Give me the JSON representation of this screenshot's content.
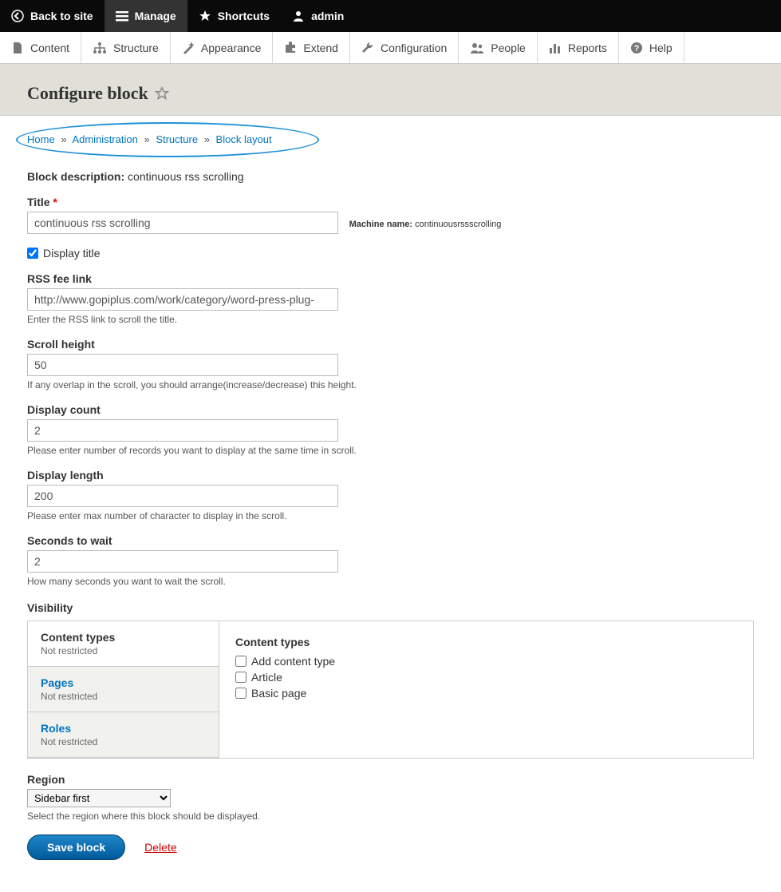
{
  "topbar": {
    "back": "Back to site",
    "manage": "Manage",
    "shortcuts": "Shortcuts",
    "admin": "admin"
  },
  "adminmenu": {
    "content": "Content",
    "structure": "Structure",
    "appearance": "Appearance",
    "extend": "Extend",
    "configuration": "Configuration",
    "people": "People",
    "reports": "Reports",
    "help": "Help"
  },
  "page_title": "Configure block",
  "breadcrumb": {
    "home": "Home",
    "administration": "Administration",
    "structure": "Structure",
    "block_layout": "Block layout"
  },
  "block_description_label": "Block description:",
  "block_description_value": "continuous rss scrolling",
  "fields": {
    "title": {
      "label": "Title",
      "value": "continuous rss scrolling"
    },
    "machine_name": {
      "label": "Machine name:",
      "value": "continuousrssscrolling"
    },
    "display_title": {
      "label": "Display title",
      "checked": true
    },
    "rss_link": {
      "label": "RSS fee link",
      "value": "http://www.gopiplus.com/work/category/word-press-plug-",
      "desc": "Enter the RSS link to scroll the title."
    },
    "scroll_height": {
      "label": "Scroll height",
      "value": "50",
      "desc": "If any overlap in the scroll, you should arrange(increase/decrease) this height."
    },
    "display_count": {
      "label": "Display count",
      "value": "2",
      "desc": "Please enter number of records you want to display at the same time in scroll."
    },
    "display_length": {
      "label": "Display length",
      "value": "200",
      "desc": "Please enter max number of character to display in the scroll."
    },
    "seconds_wait": {
      "label": "Seconds to wait",
      "value": "2",
      "desc": "How many seconds you want to wait the scroll."
    }
  },
  "visibility": {
    "heading": "Visibility",
    "tabs": [
      {
        "title": "Content types",
        "sub": "Not restricted"
      },
      {
        "title": "Pages",
        "sub": "Not restricted"
      },
      {
        "title": "Roles",
        "sub": "Not restricted"
      }
    ],
    "panel_title": "Content types",
    "options": [
      "Add content type",
      "Article",
      "Basic page"
    ]
  },
  "region": {
    "label": "Region",
    "selected": "Sidebar first",
    "desc": "Select the region where this block should be displayed."
  },
  "actions": {
    "save": "Save block",
    "delete": "Delete"
  }
}
